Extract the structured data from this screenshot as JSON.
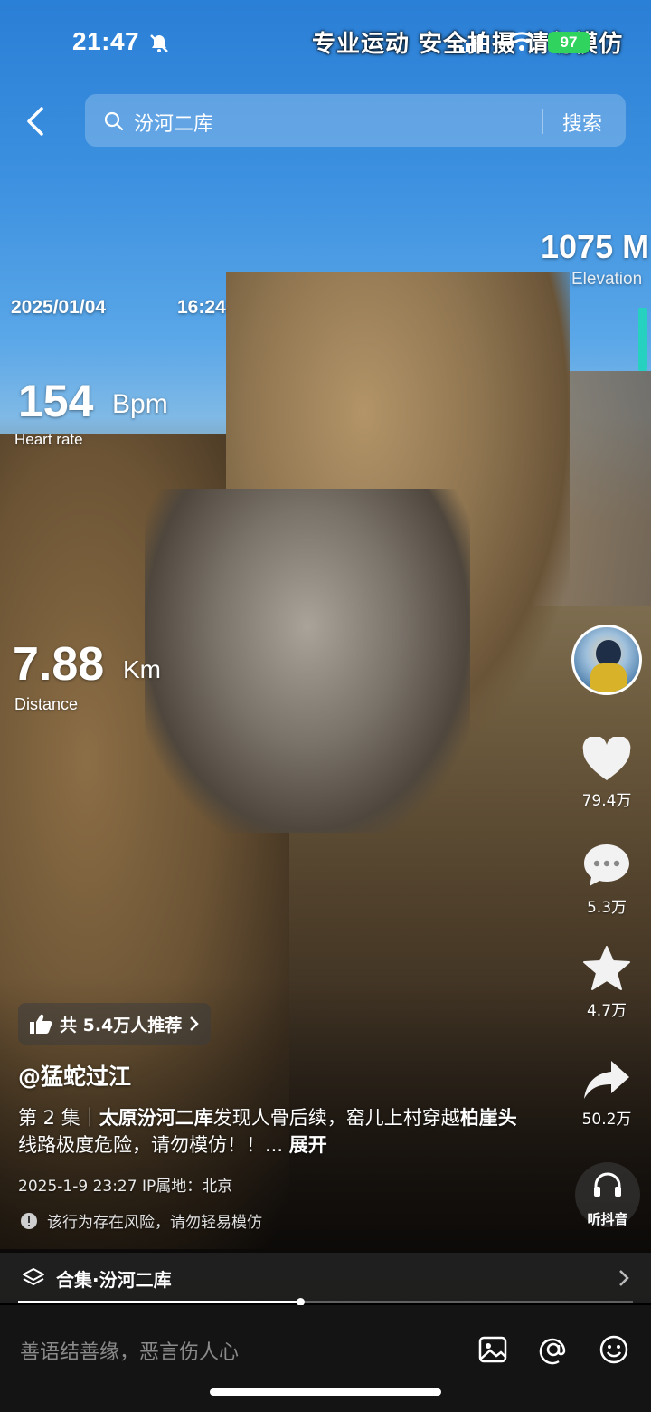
{
  "status_bar": {
    "time": "21:47",
    "banner": "专业运动 安全拍摄 请勿模仿",
    "battery": "97"
  },
  "search": {
    "query": "汾河二库",
    "button": "搜索"
  },
  "overlay": {
    "elevation_value": "1075 M",
    "elevation_label": "Elevation",
    "date": "2025/01/04",
    "time": "16:24",
    "heart_value": "154",
    "heart_unit": "Bpm",
    "heart_label": "Heart rate",
    "distance_value": "7.88",
    "distance_unit": "Km",
    "distance_label": "Distance"
  },
  "actions": {
    "likes": "79.4万",
    "comments": "5.3万",
    "favorites": "4.7万",
    "shares": "50.2万",
    "listen": "听抖音"
  },
  "info": {
    "recommend": "共 5.4万人推荐",
    "author": "@猛蛇过江",
    "desc_prefix": "第 2 集｜",
    "desc_bold1": "太原汾河二库",
    "desc_mid": "发现人骨后续，窑儿上村穿越",
    "desc_bold2": "柏崖头",
    "desc_rest": "线路极度危险，请勿模仿！！...",
    "more": "展开",
    "meta": "2025-1-9 23:27  IP属地：北京",
    "warning": "该行为存在风险，请勿轻易模仿",
    "collection": "合集·汾河二库"
  },
  "progress": {
    "fraction": 0.459
  },
  "comment_bar": {
    "placeholder": "善语结善缘，恶言伤人心"
  },
  "colors": {
    "battery": "#2fd35e",
    "elevation_bar": "#26d1c0"
  }
}
